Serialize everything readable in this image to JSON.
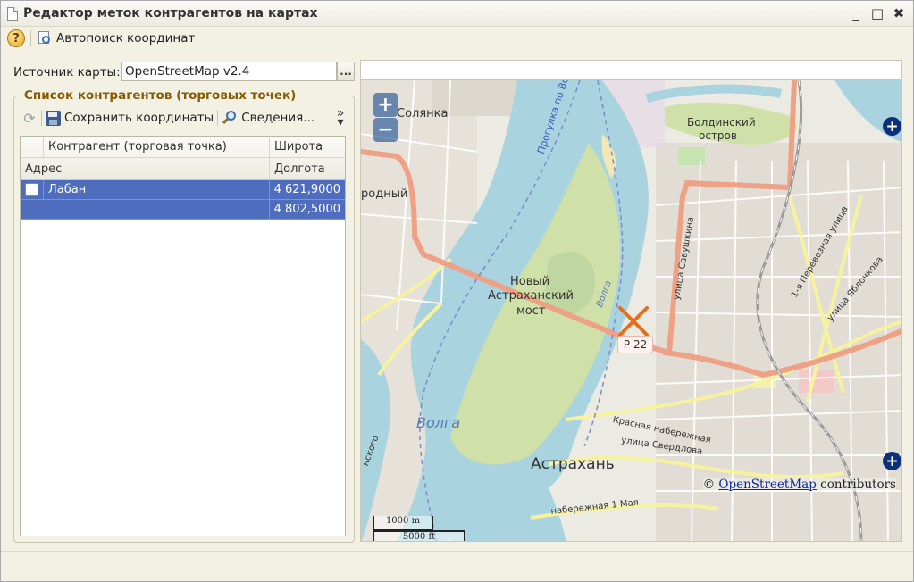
{
  "window": {
    "title": "Редактор меток контрагентов на картах",
    "controls": [
      "_",
      "□",
      "✖"
    ]
  },
  "toolbar": {
    "help_label": "?",
    "autosearch_label": "Автопоиск координат"
  },
  "source": {
    "label": "Источник карты:",
    "value": "OpenStreetMap v2.4",
    "select_btn": "..."
  },
  "group": {
    "title": "Список контрагентов (торговых точек)",
    "save_label": "Сохранить координаты",
    "info_label": "Сведения..."
  },
  "table": {
    "headers": {
      "contractor": "Контрагент (торговая точка)",
      "latitude": "Широта",
      "address": "Адрес",
      "longitude": "Долгота"
    },
    "rows": [
      {
        "name": "Лабан",
        "latitude": "4 621,9000",
        "address": "",
        "longitude": "4 802,5000"
      }
    ]
  },
  "map": {
    "zoom_in": "+",
    "zoom_out": "−",
    "layer_switcher": "+",
    "attribution_prefix": "©",
    "attribution_link": "OpenStreetMap",
    "attribution_suffix": "contributors",
    "scale_top": "1000 m",
    "scale_bottom": "5000 ft",
    "marker_label": "P-22",
    "labels": {
      "solyanka": "Солянка",
      "boldinsky": "Болдинский",
      "ostrov": "остров",
      "rodny": "родный",
      "progulka": "Прогулка по Волге на теплох",
      "novy": "Новый",
      "astrakhansky": "Астраханский",
      "most": "мост",
      "volga": "Волга",
      "volga_small": "Волга",
      "astrakhan": "Астрахань",
      "savushkina": "улица Савушкина",
      "pervomayskaya": "1-я Перевозная улица",
      "yablochkova": "улица Яблочкова",
      "krasnaya": "Красная набережная",
      "sverdlova": "улица Свердлова",
      "naberezhnaya": "набережная 1 Мая",
      "skogo": "нского"
    }
  }
}
